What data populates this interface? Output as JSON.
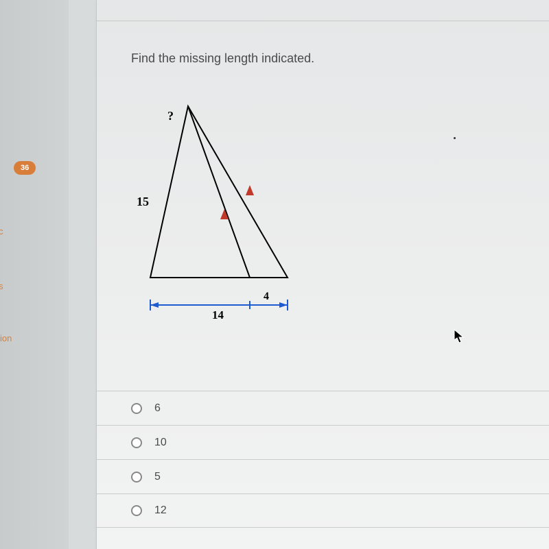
{
  "sidebar": {
    "badge": "36",
    "item_c": "c",
    "item_s": "s",
    "item_ion": "ion"
  },
  "question": {
    "prompt": "Find the missing length indicated."
  },
  "figure": {
    "label_unknown": "?",
    "label_left_side": "15",
    "label_base_right": "4",
    "label_base_total": "14"
  },
  "options": {
    "a": "6",
    "b": "10",
    "c": "5",
    "d": "12"
  }
}
